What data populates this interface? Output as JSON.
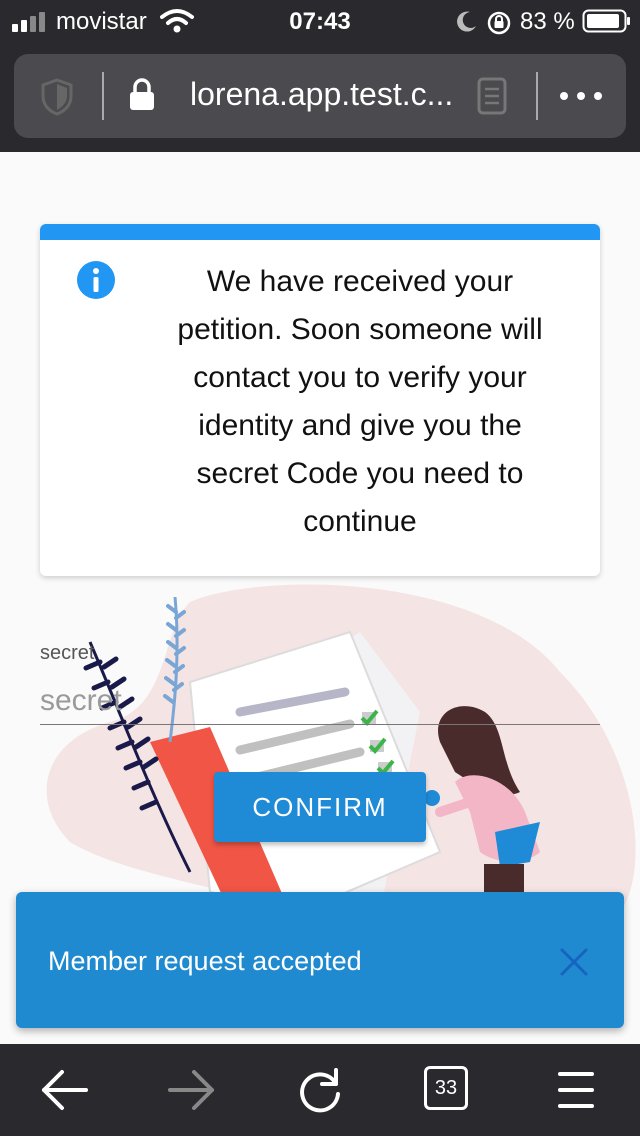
{
  "statusbar": {
    "carrier": "movistar",
    "time": "07:43",
    "battery": "83 %"
  },
  "browser": {
    "url": "lorena.app.test.c...",
    "tabs_count": "33"
  },
  "card": {
    "message": "We have received your petition. Soon someone will contact you to verify your identity and give you the secret Code you need to continue"
  },
  "form": {
    "label": "secret",
    "placeholder": "secret",
    "confirm_label": "CONFIRM"
  },
  "snackbar": {
    "message": "Member request accepted"
  },
  "colors": {
    "accent": "#2196f3",
    "button": "#1f8ad6",
    "chrome": "#2a2a2e"
  }
}
